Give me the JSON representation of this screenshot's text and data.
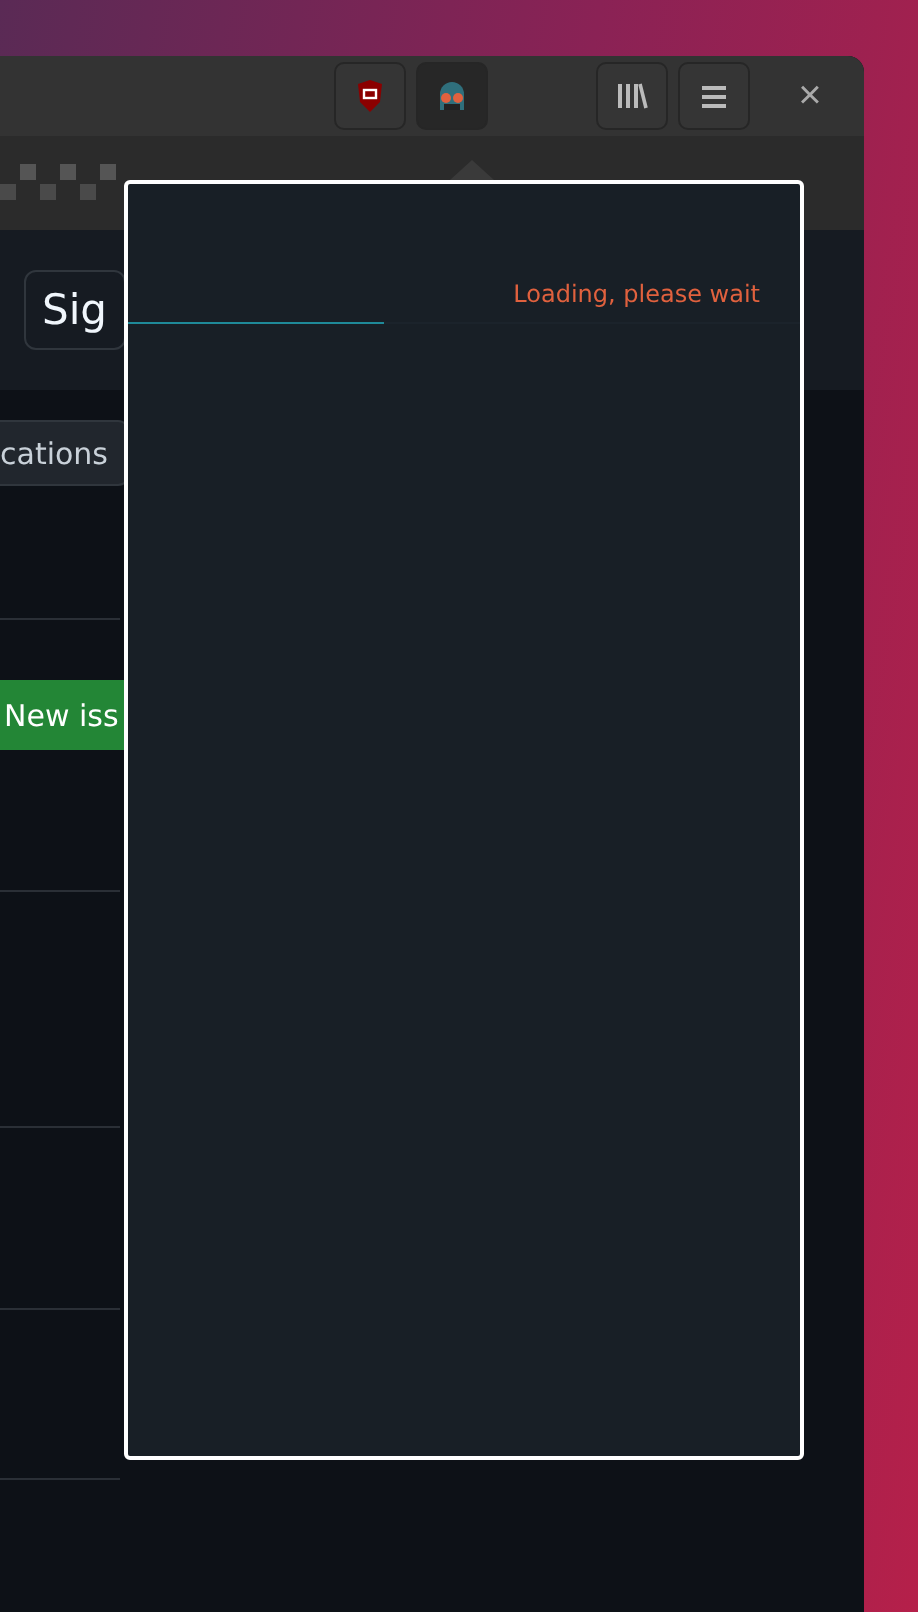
{
  "toolbar": {
    "extensions": [
      {
        "kind": "shield",
        "selected": false
      },
      {
        "kind": "mascot",
        "selected": true
      }
    ],
    "buttons": [
      {
        "kind": "library"
      },
      {
        "kind": "menu"
      }
    ],
    "close": "×"
  },
  "page": {
    "sign_button": "Sig",
    "tab_button": "cations",
    "new_issue_button": "New iss"
  },
  "popup": {
    "message": "Loading, please wait",
    "progress": {
      "level": 0.38
    }
  }
}
